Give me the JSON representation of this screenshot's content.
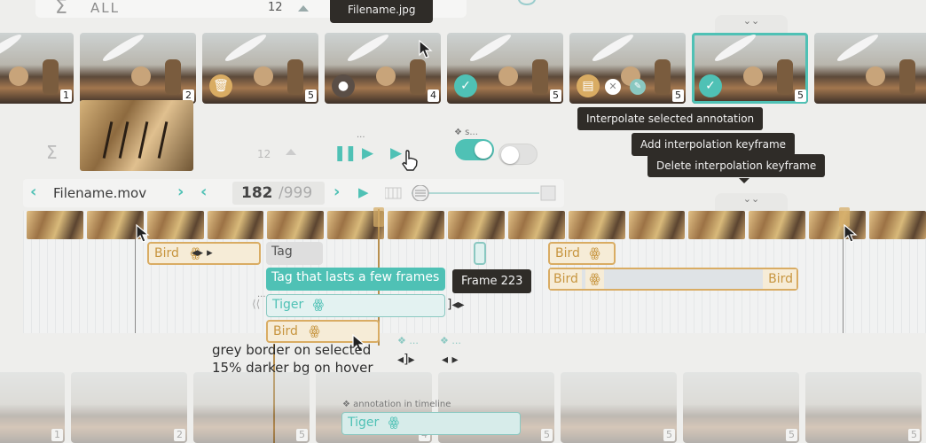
{
  "top_filter": {
    "sigma": "Σ",
    "label": "ALL",
    "count": "12"
  },
  "top_tooltip": {
    "text": "Filename.jpg"
  },
  "thumbnails": [
    {
      "num": "1"
    },
    {
      "num": "2"
    },
    {
      "num": "5"
    },
    {
      "num": "4"
    },
    {
      "num": "5"
    },
    {
      "num": "5"
    },
    {
      "num": "5"
    },
    {
      "num": ""
    }
  ],
  "tooltips": {
    "interpolate": "Interpolate selected annotation",
    "add_keyframe": "Add interpolation keyframe",
    "delete_keyframe": "Delete interpolation keyframe"
  },
  "collapse": {
    "chevron": "⌄⌄"
  },
  "player": {
    "count": "12",
    "dots": "...",
    "toggle_label": "s..."
  },
  "file_nav": {
    "filename": "Filename.mov",
    "current_frame": "182",
    "total_frames": "/999"
  },
  "timeline": {
    "annotations": {
      "bird_1": "Bird",
      "tag": "Tag",
      "tag_long": "Tag that lasts a few frames",
      "tiger": "Tiger",
      "bird_2": "Bird",
      "bird_3": "Bird",
      "bird_4": "Bird",
      "bird_5": "Bird"
    },
    "frame_tooltip": "Frame 223",
    "dots": "..."
  },
  "notes": {
    "line1": "grey border on selected",
    "line2": "15% darker bg on hover"
  },
  "bottom": {
    "caption": "annotation in timeline",
    "tiger": "Tiger",
    "numbers": [
      "1",
      "2",
      "5",
      "4",
      "5",
      "5",
      "5",
      "5"
    ]
  }
}
